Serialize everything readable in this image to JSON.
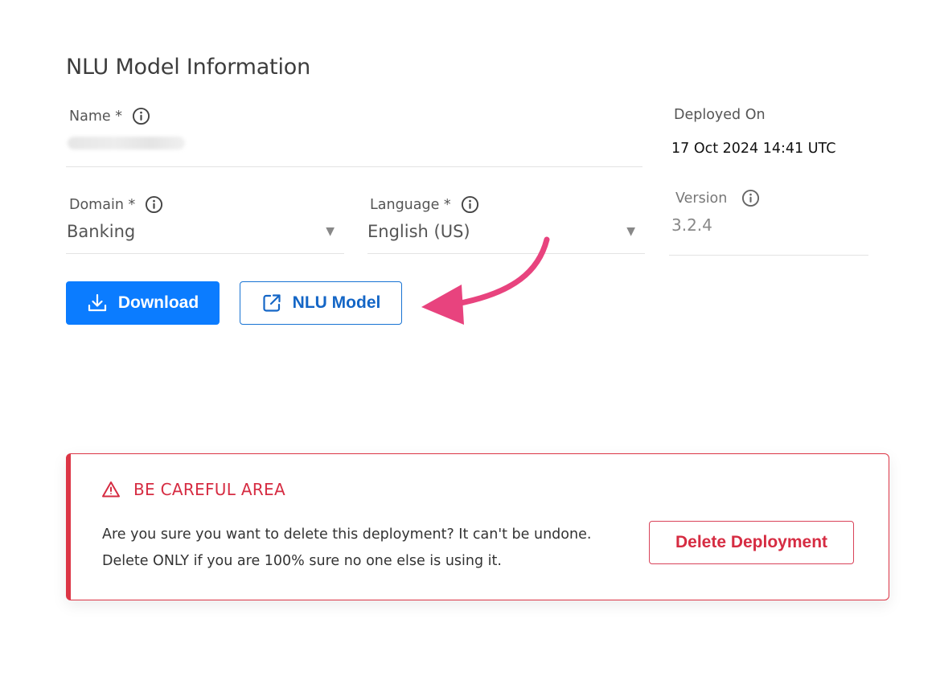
{
  "section": {
    "title": "NLU Model Information"
  },
  "fields": {
    "name": {
      "label": "Name *",
      "icon": "info-icon"
    },
    "deployed_on": {
      "label": "Deployed On",
      "value": "17 Oct 2024 14:41 UTC"
    },
    "domain": {
      "label": "Domain *",
      "value": "Banking",
      "icon": "info-icon"
    },
    "language": {
      "label": "Language *",
      "value": "English (US)",
      "icon": "info-icon"
    },
    "version": {
      "label": "Version",
      "value": "3.2.4",
      "icon": "info-icon"
    }
  },
  "actions": {
    "download_label": "Download",
    "download_icon": "download-icon",
    "nlu_model_label": "NLU Model",
    "nlu_model_icon": "external-link-icon"
  },
  "danger_zone": {
    "title": "BE CAREFUL AREA",
    "icon": "warning-icon",
    "message": "Are you sure you want to delete this deployment? It can't be undone. Delete ONLY if you are 100% sure no one else is using it.",
    "delete_label": "Delete Deployment"
  },
  "colors": {
    "primary": "#0b7cff",
    "danger": "#dc3545",
    "annotation_arrow": "#e8437e"
  }
}
